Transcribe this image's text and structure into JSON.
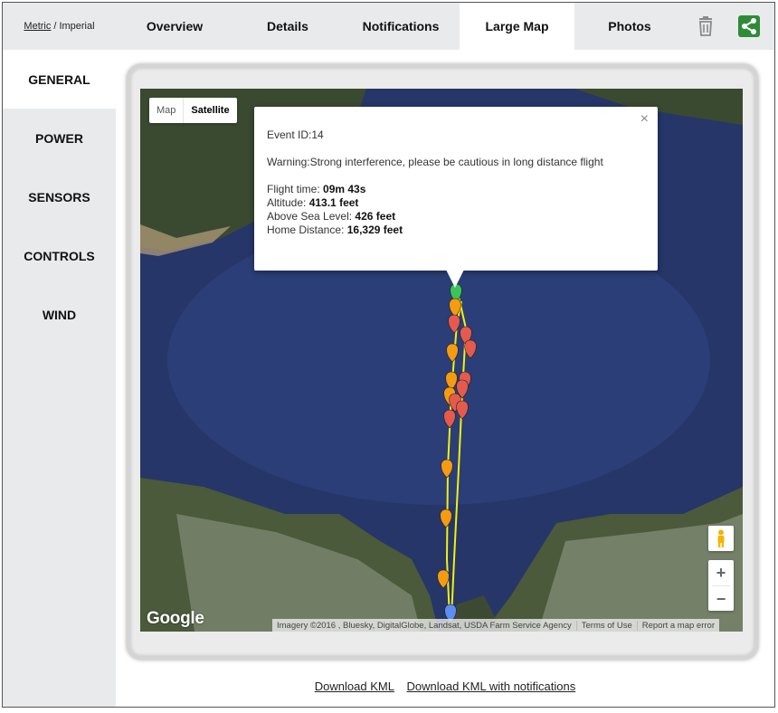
{
  "units": {
    "metric": "Metric",
    "separator": "/",
    "imperial": "Imperial"
  },
  "tabs": [
    {
      "label": "Overview"
    },
    {
      "label": "Details"
    },
    {
      "label": "Notifications"
    },
    {
      "label": "Large Map",
      "active": true
    },
    {
      "label": "Photos"
    }
  ],
  "toolbar_icons": [
    "trash-icon",
    "share-icon"
  ],
  "colors": {
    "share_green": "#2e8b3a",
    "marker_red": "#e55a4e",
    "marker_orange": "#f59b12",
    "marker_blue": "#5b8ef0",
    "path_yellow": "#f2f20a"
  },
  "sidebar": {
    "items": [
      {
        "label": "GENERAL",
        "active": true
      },
      {
        "label": "POWER"
      },
      {
        "label": "SENSORS"
      },
      {
        "label": "CONTROLS"
      },
      {
        "label": "WIND"
      }
    ]
  },
  "map": {
    "type_buttons": {
      "map": "Map",
      "satellite": "Satellite"
    },
    "logo": "Google",
    "attribution": "Imagery ©2016 , Bluesky, DigitalGlobe, Landsat, USDA Farm Service Agency",
    "terms": "Terms of Use",
    "report": "Report a map error",
    "zoom_in": "+",
    "zoom_out": "−",
    "info": {
      "event_id": "Event ID:14",
      "warning": "Warning:Strong interference, please be cautious in long distance flight",
      "flight_time_label": "Flight time:",
      "flight_time_value": "09m 43s",
      "altitude_label": "Altitude:",
      "altitude_value": "413.1 feet",
      "asl_label": "Above Sea Level:",
      "asl_value": "426 feet",
      "home_distance_label": "Home Distance:",
      "home_distance_value": "16,329 feet",
      "close": "×"
    }
  },
  "downloads": {
    "kml": "Download KML",
    "kml_notifications": "Download KML with notifications"
  }
}
